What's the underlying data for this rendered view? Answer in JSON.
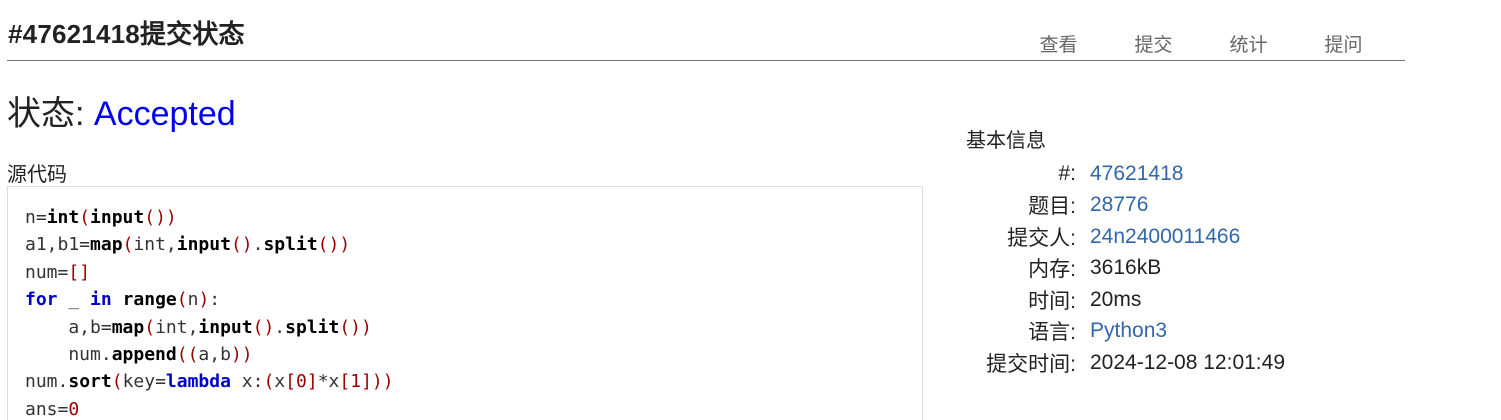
{
  "header": {
    "title": "#47621418提交状态",
    "nav": [
      "查看",
      "提交",
      "统计",
      "提问"
    ]
  },
  "status": {
    "label": "状态: ",
    "value": "Accepted"
  },
  "source": {
    "label": "源代码",
    "lines": [
      [
        {
          "t": "n=",
          "c": "plain"
        },
        {
          "t": "int",
          "c": "bold"
        },
        {
          "t": "(",
          "c": "punc"
        },
        {
          "t": "input",
          "c": "bold"
        },
        {
          "t": "())",
          "c": "punc"
        }
      ],
      [
        {
          "t": "a1,b1=",
          "c": "plain"
        },
        {
          "t": "map",
          "c": "bold"
        },
        {
          "t": "(",
          "c": "punc"
        },
        {
          "t": "int,",
          "c": "plain"
        },
        {
          "t": "input",
          "c": "bold"
        },
        {
          "t": "()",
          "c": "punc"
        },
        {
          "t": ".",
          "c": "plain"
        },
        {
          "t": "split",
          "c": "bold"
        },
        {
          "t": "())",
          "c": "punc"
        }
      ],
      [
        {
          "t": "num=",
          "c": "plain"
        },
        {
          "t": "[]",
          "c": "punc"
        }
      ],
      [
        {
          "t": "for",
          "c": "kw"
        },
        {
          "t": " _ ",
          "c": "plain"
        },
        {
          "t": "in",
          "c": "kw"
        },
        {
          "t": " ",
          "c": "plain"
        },
        {
          "t": "range",
          "c": "bold"
        },
        {
          "t": "(",
          "c": "punc"
        },
        {
          "t": "n",
          "c": "plain"
        },
        {
          "t": ")",
          "c": "punc"
        },
        {
          "t": ":",
          "c": "plain"
        }
      ],
      [
        {
          "t": "    a,b=",
          "c": "plain"
        },
        {
          "t": "map",
          "c": "bold"
        },
        {
          "t": "(",
          "c": "punc"
        },
        {
          "t": "int,",
          "c": "plain"
        },
        {
          "t": "input",
          "c": "bold"
        },
        {
          "t": "()",
          "c": "punc"
        },
        {
          "t": ".",
          "c": "plain"
        },
        {
          "t": "split",
          "c": "bold"
        },
        {
          "t": "())",
          "c": "punc"
        }
      ],
      [
        {
          "t": "    num.",
          "c": "plain"
        },
        {
          "t": "append",
          "c": "bold"
        },
        {
          "t": "((",
          "c": "punc"
        },
        {
          "t": "a,b",
          "c": "plain"
        },
        {
          "t": "))",
          "c": "punc"
        }
      ],
      [
        {
          "t": "num.",
          "c": "plain"
        },
        {
          "t": "sort",
          "c": "bold"
        },
        {
          "t": "(",
          "c": "punc"
        },
        {
          "t": "key=",
          "c": "plain"
        },
        {
          "t": "lambda",
          "c": "kw"
        },
        {
          "t": " x:",
          "c": "plain"
        },
        {
          "t": "(",
          "c": "punc"
        },
        {
          "t": "x",
          "c": "plain"
        },
        {
          "t": "[",
          "c": "punc"
        },
        {
          "t": "0",
          "c": "num"
        },
        {
          "t": "]",
          "c": "punc"
        },
        {
          "t": "*x",
          "c": "plain"
        },
        {
          "t": "[",
          "c": "punc"
        },
        {
          "t": "1",
          "c": "num"
        },
        {
          "t": "]))",
          "c": "punc"
        }
      ],
      [
        {
          "t": "ans=",
          "c": "plain"
        },
        {
          "t": "0",
          "c": "num"
        }
      ]
    ]
  },
  "info": {
    "title": "基本信息",
    "rows": [
      {
        "label": "#:",
        "value": "47621418",
        "link": true
      },
      {
        "label": "题目:",
        "value": "28776",
        "link": true
      },
      {
        "label": "提交人:",
        "value": "24n2400011466",
        "link": true
      },
      {
        "label": "内存:",
        "value": "3616kB",
        "link": false
      },
      {
        "label": "时间:",
        "value": "20ms",
        "link": false
      },
      {
        "label": "语言:",
        "value": "Python3",
        "link": true
      },
      {
        "label": "提交时间:",
        "value": "2024-12-08 12:01:49",
        "link": false
      }
    ]
  }
}
